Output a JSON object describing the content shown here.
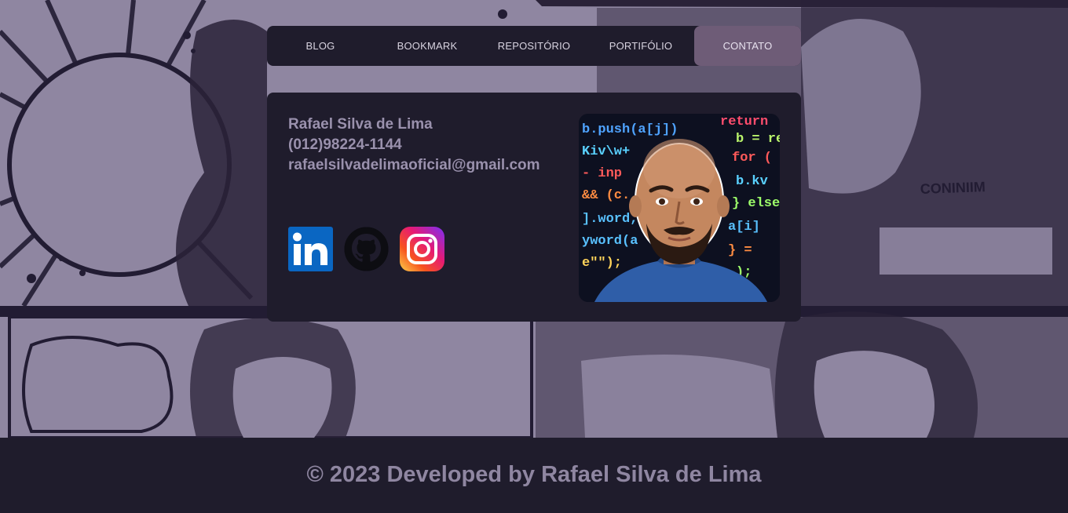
{
  "nav": {
    "items": [
      {
        "label": "BLOG",
        "active": false
      },
      {
        "label": "BOOKMARK",
        "active": false
      },
      {
        "label": "REPOSITÓRIO",
        "active": false
      },
      {
        "label": "PORTIFÓLIO",
        "active": false
      },
      {
        "label": "CONTATO",
        "active": true
      }
    ]
  },
  "contact": {
    "name": "Rafael Silva de Lima",
    "phone": "(012)98224-1144",
    "email": "rafaelsilvadelimaoficial@gmail.com"
  },
  "socials": [
    {
      "name": "linkedin",
      "icon": "linkedin-icon"
    },
    {
      "name": "github",
      "icon": "github-icon"
    },
    {
      "name": "instagram",
      "icon": "instagram-icon"
    }
  ],
  "photo": {
    "code_lines": [
      "b.push(a[j]);",
      "Kiv\\w+",
      "inp",
      "&& (c.",
      "].word,",
      "yword(a",
      "e\"\");",
      "return",
      "b = re",
      "for (",
      "b.kv",
      "} else"
    ]
  },
  "footer": {
    "text": "© 2023 Developed by Rafael Silva de Lima"
  },
  "colors": {
    "background_panel": "#1f1c2c",
    "accent_active": "#6e5c77",
    "text_muted": "#9a91ad",
    "manga_bg": "#8f86a1"
  }
}
